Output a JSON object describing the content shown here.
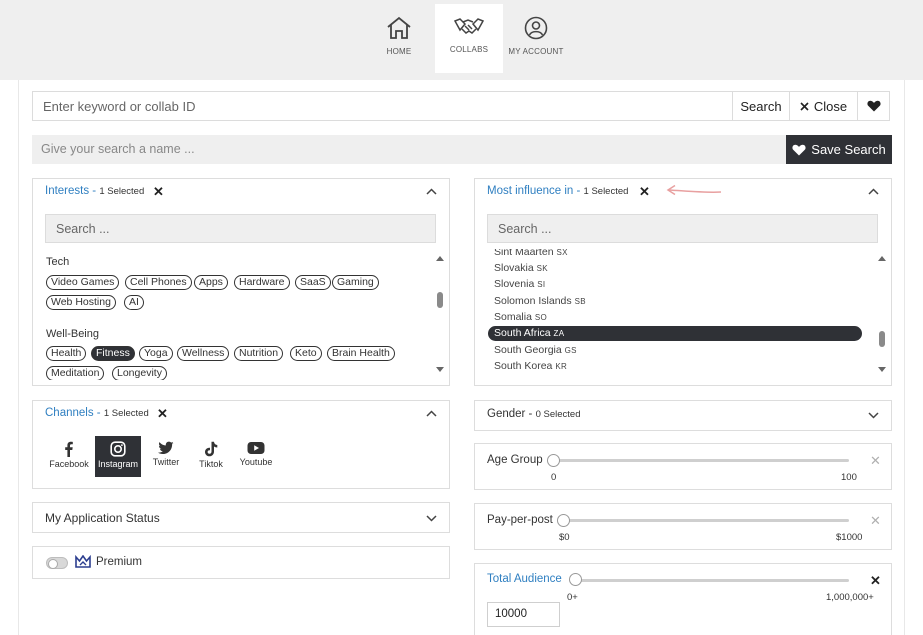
{
  "nav": {
    "items": [
      {
        "label": "HOME",
        "icon": "home-icon"
      },
      {
        "label": "COLLABS",
        "icon": "handshake-icon"
      },
      {
        "label": "MY ACCOUNT",
        "icon": "account-icon"
      }
    ],
    "active": "COLLABS"
  },
  "search": {
    "keyword_placeholder": "Enter keyword or collab ID",
    "search_label": "Search",
    "close_label": "Close",
    "name_placeholder": "Give your search a name ...",
    "save_label": "Save Search"
  },
  "interests": {
    "title": "Interests",
    "count": "1 Selected",
    "search_placeholder": "Search ...",
    "categories": [
      {
        "name": "Tech",
        "tags": [
          "Video Games",
          "Cell Phones",
          "Apps",
          "Hardware",
          "SaaS",
          "Gaming",
          "Web Hosting",
          "AI"
        ]
      },
      {
        "name": "Well-Being",
        "tags": [
          "Health",
          "Fitness",
          "Yoga",
          "Wellness",
          "Nutrition",
          "Keto",
          "Brain Health",
          "Meditation",
          "Longevity"
        ]
      }
    ],
    "selected": "Fitness"
  },
  "influence": {
    "title": "Most influence in",
    "count": "1 Selected",
    "search_placeholder": "Search ...",
    "countries": [
      {
        "name": "Sint Maarten",
        "code": "SX"
      },
      {
        "name": "Slovakia",
        "code": "SK"
      },
      {
        "name": "Slovenia",
        "code": "SI"
      },
      {
        "name": "Solomon Islands",
        "code": "SB"
      },
      {
        "name": "Somalia",
        "code": "SO"
      },
      {
        "name": "South Africa",
        "code": "ZA"
      },
      {
        "name": "South Georgia",
        "code": "GS"
      },
      {
        "name": "South Korea",
        "code": "KR"
      }
    ],
    "selected": "South Africa"
  },
  "channels": {
    "title": "Channels",
    "count": "1 Selected",
    "items": [
      {
        "label": "Facebook",
        "icon": "facebook-icon"
      },
      {
        "label": "Instagram",
        "icon": "instagram-icon"
      },
      {
        "label": "Twitter",
        "icon": "twitter-icon"
      },
      {
        "label": "Tiktok",
        "icon": "tiktok-icon"
      },
      {
        "label": "Youtube",
        "icon": "youtube-icon"
      }
    ],
    "selected": "Instagram"
  },
  "application_status": {
    "title": "My Application Status"
  },
  "premium": {
    "label": "Premium",
    "enabled": false
  },
  "gender": {
    "title": "Gender",
    "count": "0 Selected"
  },
  "age_group": {
    "title": "Age Group",
    "min_label": "0",
    "max_label": "100",
    "value": 0
  },
  "pay_per_post": {
    "title": "Pay-per-post",
    "min_label": "$0",
    "max_label": "$1000",
    "value": 0
  },
  "total_audience": {
    "title": "Total Audience",
    "min_label": "0+",
    "max_label": "1,000,000+",
    "input_value": "10000",
    "value": 0
  },
  "colors": {
    "accent": "#2f7fc1",
    "dark": "#2f3136",
    "nav_bg": "#efefef",
    "annotation_arrow": "#e8a0a0"
  }
}
